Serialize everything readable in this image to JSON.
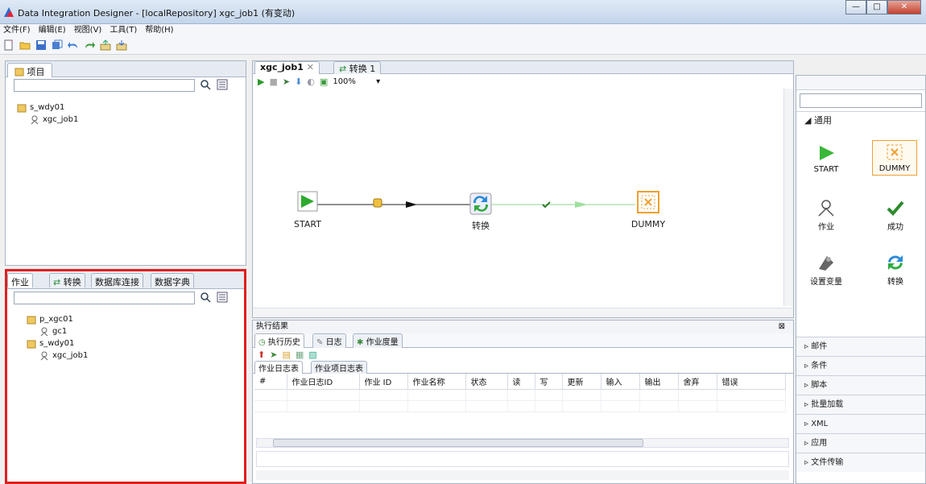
{
  "window": {
    "title": "Data Integration Designer - [localRepository] xgc_job1 (有变动)"
  },
  "menu": [
    "文件(F)",
    "编辑(E)",
    "视图(V)",
    "工具(T)",
    "帮助(H)"
  ],
  "project_panel": {
    "tab": "项目",
    "tree": [
      {
        "label": "s_wdy01",
        "level": 0
      },
      {
        "label": "xgc_job1",
        "level": 1
      }
    ]
  },
  "lower_panel": {
    "tabs": [
      "作业",
      "转换",
      "数据库连接",
      "数据字典"
    ],
    "tree": [
      {
        "label": "p_xgc01",
        "level": 0
      },
      {
        "label": "gc1",
        "level": 1
      },
      {
        "label": "s_wdy01",
        "level": 0
      },
      {
        "label": "xgc_job1",
        "level": 1
      }
    ]
  },
  "editor": {
    "tabs": [
      "xgc_job1",
      "转换 1"
    ],
    "zoom": "100%",
    "nodes": {
      "start": "START",
      "trans": "转换",
      "dummy": "DUMMY"
    }
  },
  "results": {
    "title": "执行结果",
    "tabs": [
      "执行历史",
      "日志",
      "作业度量"
    ],
    "subtabs": [
      "作业日志表",
      "作业项日志表"
    ],
    "columns": [
      "#",
      "作业日志ID",
      "作业 ID",
      "作业名称",
      "状态",
      "读",
      "写",
      "更新",
      "输入",
      "输出",
      "舍弃",
      "错误"
    ]
  },
  "palette": {
    "section_open": "通用",
    "items": [
      "START",
      "DUMMY",
      "作业",
      "成功",
      "设置变量",
      "转换"
    ],
    "sections": [
      "邮件",
      "条件",
      "脚本",
      "批量加载",
      "XML",
      "应用",
      "文件传输"
    ]
  },
  "colors": {
    "accent_green": "#3aa33a",
    "highlight_red": "#e01f1f",
    "dummy_orange": "#f0a030"
  }
}
